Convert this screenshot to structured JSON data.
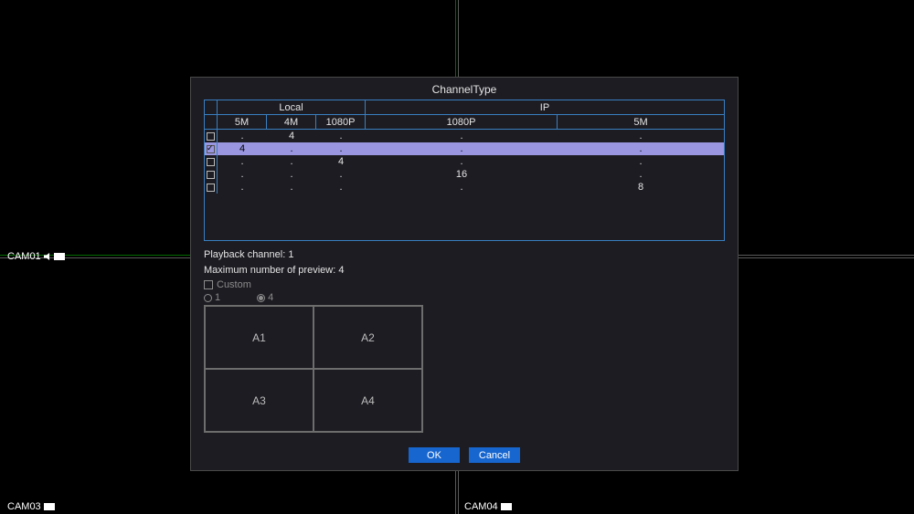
{
  "background": {
    "cams": {
      "cam1": "CAM01",
      "cam3": "CAM03",
      "cam4": "CAM04"
    }
  },
  "dialog": {
    "title": "ChannelType",
    "group_headers": {
      "local": "Local",
      "ip": "IP"
    },
    "col_headers": {
      "c1": "5M",
      "c2": "4M",
      "c3": "1080P",
      "c4": "1080P",
      "c5": "5M"
    },
    "rows": [
      {
        "checked": false,
        "c1": ".",
        "c2": "4",
        "c3": ".",
        "c4": ".",
        "c5": "."
      },
      {
        "checked": true,
        "c1": "4",
        "c2": ".",
        "c3": ".",
        "c4": ".",
        "c5": "."
      },
      {
        "checked": false,
        "c1": ".",
        "c2": ".",
        "c3": "4",
        "c4": ".",
        "c5": "."
      },
      {
        "checked": false,
        "c1": ".",
        "c2": ".",
        "c3": ".",
        "c4": "16",
        "c5": "."
      },
      {
        "checked": false,
        "c1": ".",
        "c2": ".",
        "c3": ".",
        "c4": ".",
        "c5": "8"
      }
    ],
    "selected_row_index": 1,
    "info": {
      "playback_line": "Playback channel: 1",
      "preview_line": "Maximum number of preview: 4"
    },
    "custom_label": "Custom",
    "radios": {
      "opt1": "1",
      "opt2": "4",
      "selected": "4"
    },
    "preview_cells": [
      "A1",
      "A2",
      "A3",
      "A4"
    ],
    "buttons": {
      "ok": "OK",
      "cancel": "Cancel"
    }
  }
}
